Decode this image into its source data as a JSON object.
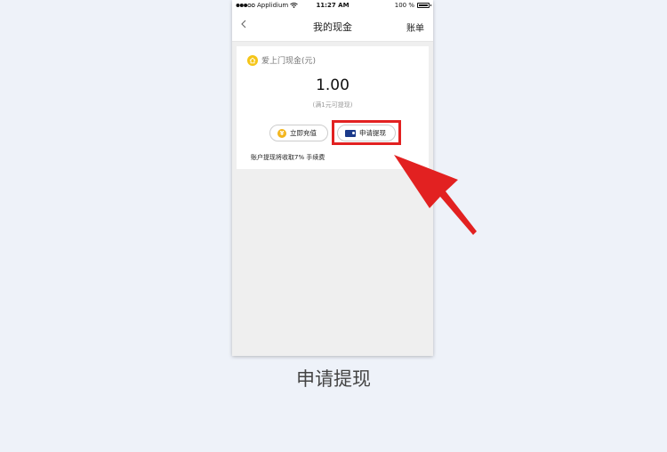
{
  "status_bar": {
    "carrier": "Applidium",
    "time": "11:27 AM",
    "battery_text": "100 %",
    "battery_level_percent": 100
  },
  "nav": {
    "back_icon": "chevron-left-icon",
    "title": "我的现金",
    "right_label": "账单"
  },
  "card": {
    "label": "爱上门现金(元)",
    "amount": "1.00",
    "hint": "(满1元可提现)",
    "recharge_label": "立即充值",
    "withdraw_label": "申请提现",
    "fee_note": "账户提现将收取7% 手续费",
    "yen_glyph": "¥"
  },
  "annotation": {
    "caption": "申请提现",
    "highlight_color": "#e22121"
  }
}
